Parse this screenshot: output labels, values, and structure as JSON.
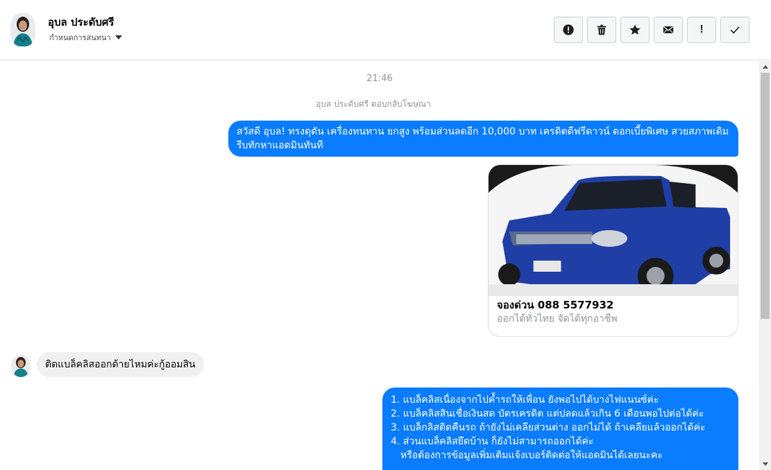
{
  "header": {
    "contact_name": "อุบล ประดับศรี",
    "assign_label": "กำหนดการสนทนา",
    "toolbar": [
      {
        "name": "spam-button",
        "icon": "alert-circle-icon"
      },
      {
        "name": "delete-button",
        "icon": "trash-icon"
      },
      {
        "name": "star-button",
        "icon": "star-icon"
      },
      {
        "name": "mark-unread-button",
        "icon": "envelope-icon"
      },
      {
        "name": "important-button",
        "icon": "exclamation-icon",
        "glyph": "!"
      },
      {
        "name": "mark-done-button",
        "icon": "check-icon"
      }
    ]
  },
  "chat": {
    "timestamp": "21:46",
    "replied_note": "อุบล ประดับศรี ตอบกลับโฆษณา",
    "outgoing_message_1": "สวัสดี อุบล!  ทรงดุดัน เครื่องทนทาน ยกสูง พร้อมส่วนลดอีก 10,000 บาท เครดิตดีฟรีดาวน์ ดอกเบี้ยพิเศษ สวยสภาพเดิม รีบทักหาแอดมินทันที",
    "ad_card": {
      "title": "จองด่วน 088 5577932",
      "subtitle": "ออกได้ทั่วไทย จัดได้ทุกอาชีพ",
      "image": "blue-pickup-truck"
    },
    "incoming_message": "ติดแบล็คลิสออกด้ายไหมค่ะกู้ออมสิน",
    "outgoing_message_2": {
      "lines": [
        "1. แบล็คลิสเนื่องจากไปค้ำรถให้เพื่อน ยังพอไปได้บางไฟแนนซ์ค่ะ",
        "2. แบล็คลิสสินเชื่อเงินสด บัตรเครดิต แต่ปลดแล้วเกิน 6 เดือนพอไปต่อได้ค่ะ",
        "3. แบล็กลิสติดคืนรถ ถ้ายังไม่เคลียส่วนต่าง ออกไม่ได้ ถ้าเคลียแล้วออกได้ค่ะ",
        "4. ส่วนแบล็คลิสยึดบ้าน ก็ยังไม่สามารถออกได้ค่ะ",
        "หรือต้องการข้อมูลเพิ่มเติมแจ้งเบอร์ติดต่อให้แอดมินได้เลยนะคะ"
      ]
    }
  },
  "colors": {
    "outgoing_bubble": "#0a7cff",
    "incoming_bubble": "#f0f0f0",
    "meta_text": "#90949c"
  }
}
